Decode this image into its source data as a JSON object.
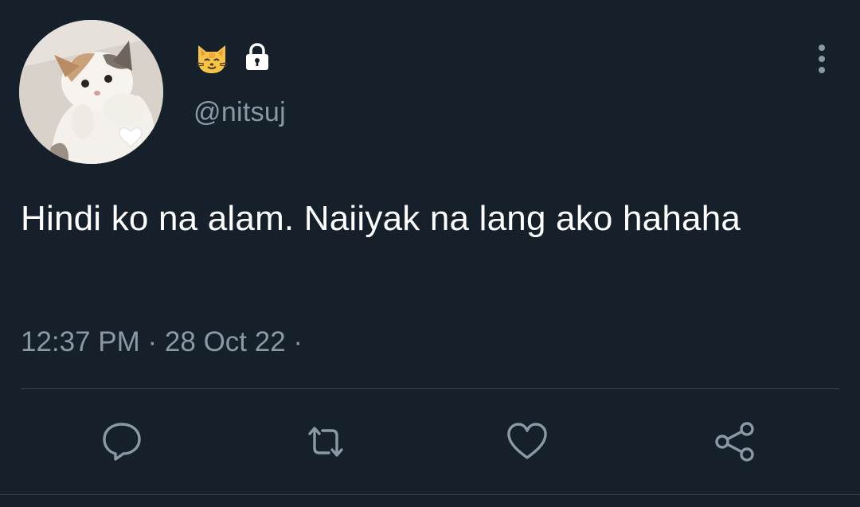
{
  "user": {
    "handle": "@nitsuj",
    "name_emoji": "cat-face-emoji",
    "protected_icon": "lock-icon"
  },
  "tweet": {
    "text": "Hindi ko na alam. Naiiyak na lang ako hahaha",
    "time": "12:37 PM",
    "separator": " · ",
    "date": "28 Oct 22",
    "trailing_separator": " ·"
  },
  "actions": {
    "icons": [
      "reply-icon",
      "retweet-icon",
      "like-icon",
      "share-icon"
    ]
  },
  "colors": {
    "background": "#15202b",
    "text": "#ffffff",
    "secondary": "#8b98a5",
    "divider": "#38444d"
  }
}
